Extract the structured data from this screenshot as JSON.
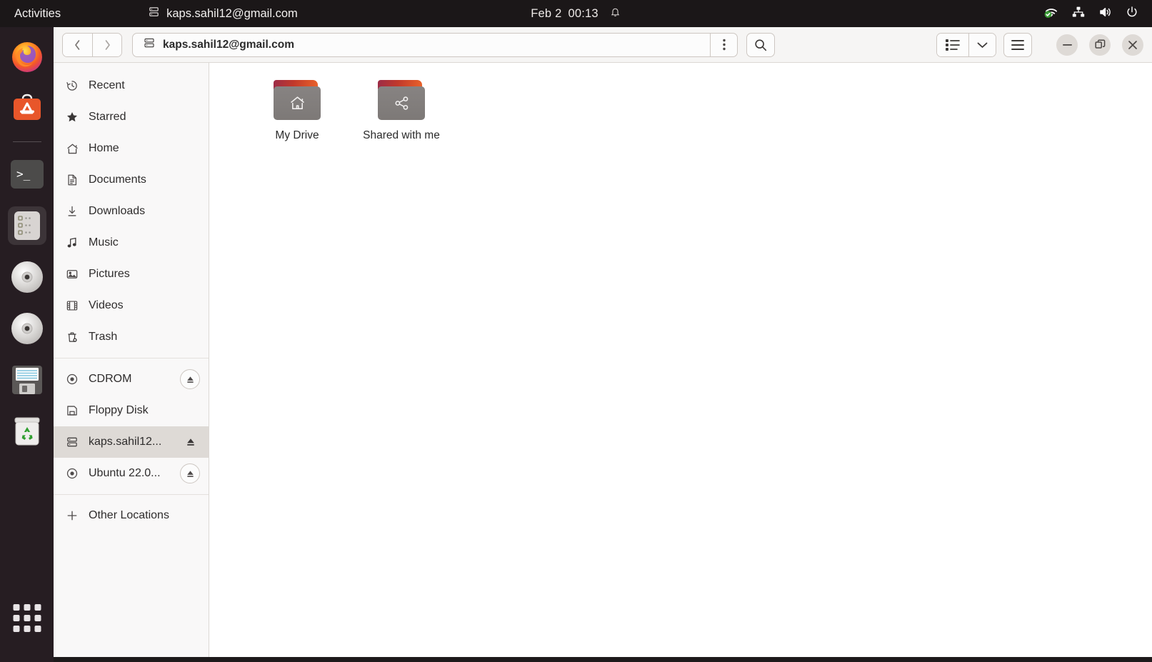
{
  "topbar": {
    "activities": "Activities",
    "window_title": "kaps.sahil12@gmail.com",
    "window_title_icon": "drive-icon",
    "date": "Feb 2",
    "time": "00:13",
    "notification_icon": "bell-icon",
    "tray": [
      {
        "name": "network-wifi-connected-icon"
      },
      {
        "name": "network-wired-icon"
      },
      {
        "name": "volume-icon"
      },
      {
        "name": "power-icon"
      }
    ]
  },
  "dock": {
    "items": [
      {
        "name": "firefox",
        "label": "Firefox",
        "running": false
      },
      {
        "name": "ubuntu-software",
        "label": "Ubuntu Software",
        "running": false
      },
      {
        "name": "terminal",
        "label": "Terminal",
        "running": false
      },
      {
        "name": "files",
        "label": "Files",
        "running": true
      },
      {
        "name": "cdrom-1",
        "label": "CD/DVD Disc",
        "running": false
      },
      {
        "name": "cdrom-2",
        "label": "CD/DVD Disc",
        "running": false
      },
      {
        "name": "floppy-disk",
        "label": "Floppy Disk",
        "running": false
      },
      {
        "name": "trash",
        "label": "Trash",
        "running": false
      }
    ],
    "show_applications": "Show Applications"
  },
  "headerbar": {
    "back_label": "‹",
    "forward_label": "›",
    "path_label": "kaps.sahil12@gmail.com",
    "path_icon": "drive-icon",
    "path_menu_icon": "kebab-menu-icon",
    "search_icon": "search-icon",
    "view_list_icon": "list-view-icon",
    "view_chevron_icon": "chevron-down-icon",
    "menu_icon": "hamburger-menu-icon",
    "minimize_icon": "minimize-icon",
    "maximize_icon": "restore-icon",
    "close_icon": "close-icon"
  },
  "sidebar": {
    "places": [
      {
        "label": "Recent",
        "icon": "clock-icon",
        "selected": false,
        "eject": "none"
      },
      {
        "label": "Starred",
        "icon": "star-icon",
        "selected": false,
        "eject": "none"
      },
      {
        "label": "Home",
        "icon": "home-icon",
        "selected": false,
        "eject": "none"
      },
      {
        "label": "Documents",
        "icon": "document-icon",
        "selected": false,
        "eject": "none"
      },
      {
        "label": "Downloads",
        "icon": "download-icon",
        "selected": false,
        "eject": "none"
      },
      {
        "label": "Music",
        "icon": "music-icon",
        "selected": false,
        "eject": "none"
      },
      {
        "label": "Pictures",
        "icon": "picture-icon",
        "selected": false,
        "eject": "none"
      },
      {
        "label": "Videos",
        "icon": "video-icon",
        "selected": false,
        "eject": "none"
      },
      {
        "label": "Trash",
        "icon": "trash-icon",
        "selected": false,
        "eject": "none"
      }
    ],
    "devices": [
      {
        "label": "CDROM",
        "icon": "disc-icon",
        "selected": false,
        "eject": "circle"
      },
      {
        "label": "Floppy Disk",
        "icon": "floppy-icon",
        "selected": false,
        "eject": "none"
      },
      {
        "label": "kaps.sahil12...",
        "icon": "drive-icon",
        "selected": true,
        "eject": "plain"
      },
      {
        "label": "Ubuntu 22.0...",
        "icon": "disc-icon",
        "selected": false,
        "eject": "circle"
      }
    ],
    "other": {
      "label": "Other Locations",
      "icon": "plus-icon"
    }
  },
  "files": [
    {
      "label": "My Drive",
      "icon": "home-folder-icon"
    },
    {
      "label": "Shared with me",
      "icon": "shared-folder-icon"
    }
  ],
  "colors": {
    "dock_bg": "#261d22",
    "topbar_bg": "#1b1718",
    "headerbar_bg": "#f6f5f4",
    "sidebar_bg": "#f9f8f8",
    "selection_bg": "#dedad6",
    "folder_tab_start": "#9c2b47",
    "folder_tab_end": "#e9622a",
    "folder_body": "#7d7977"
  }
}
